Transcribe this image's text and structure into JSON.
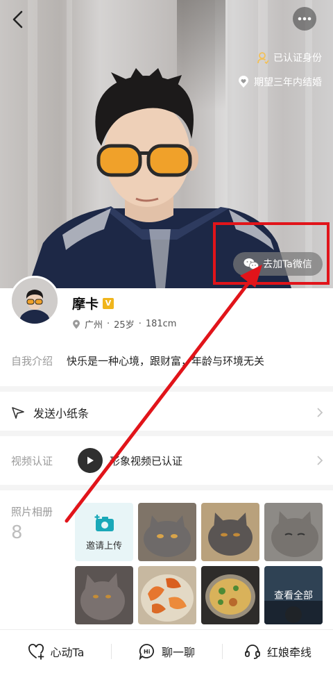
{
  "header": {
    "back_icon": "chevron-left-icon",
    "more_icon": "ellipsis-icon",
    "tags": [
      {
        "icon": "user-verified-icon",
        "label": "已认证身份"
      },
      {
        "icon": "heart-location-icon",
        "label": "期望三年内结婚"
      }
    ],
    "wechat_button": "去加Ta微信"
  },
  "profile": {
    "name": "摩卡",
    "vip_badge": "V",
    "location": "广州",
    "age": "25岁",
    "height": "181cm"
  },
  "intro": {
    "label": "自我介绍",
    "text": "快乐是一种心境，跟财富，年龄与环境无关"
  },
  "memo": {
    "label": "发送小纸条"
  },
  "video": {
    "label": "视频认证",
    "status": "形象视频已认证"
  },
  "album": {
    "label": "照片相册",
    "count": "8",
    "upload_label": "邀请上传",
    "see_all": "查看全部"
  },
  "bottom_bar": {
    "items": [
      {
        "icon": "heart-plus-icon",
        "label": "心动Ta"
      },
      {
        "icon": "chat-hi-icon",
        "label": "聊一聊"
      },
      {
        "icon": "headset-icon",
        "label": "红娘牵线"
      }
    ]
  },
  "colors": {
    "highlight_red": "#e1141a",
    "accent_teal": "#1aa8b8",
    "vip_gold": "#f0b51c",
    "tag_gold": "#f2c15a"
  }
}
